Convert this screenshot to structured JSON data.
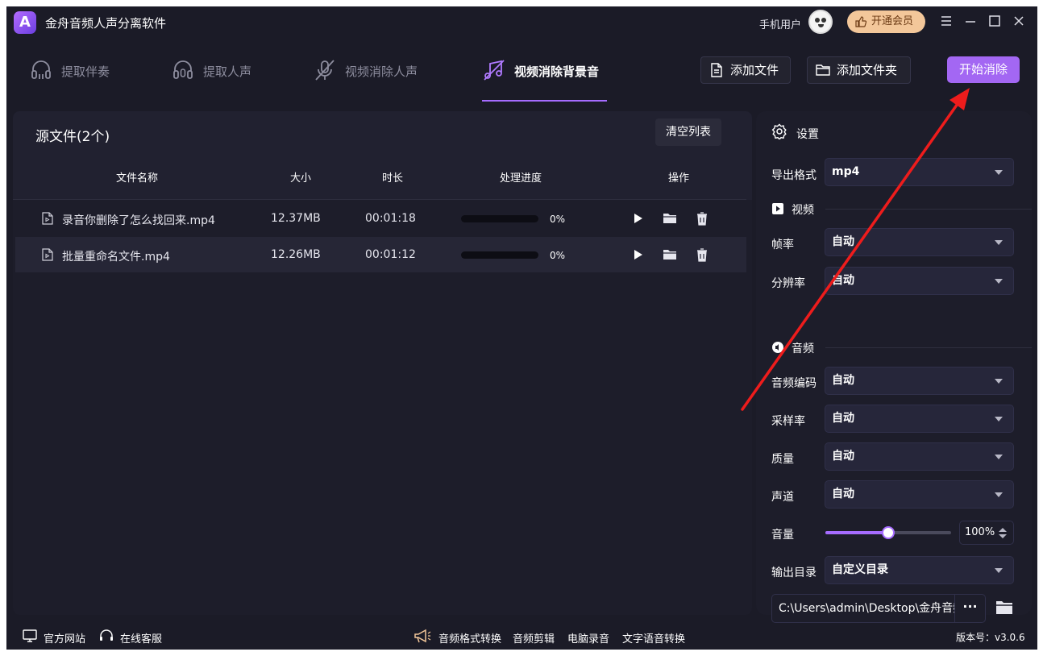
{
  "app": {
    "title": "金舟音频人声分离软件",
    "user_label": "手机用户",
    "vip_label": "开通会员"
  },
  "tabs": [
    {
      "label": "提取伴奏",
      "icon": "headphones-icon",
      "active": false
    },
    {
      "label": "提取人声",
      "icon": "headset-mic-icon",
      "active": false
    },
    {
      "label": "视频消除人声",
      "icon": "mic-off-icon",
      "active": false
    },
    {
      "label": "视频消除背景音",
      "icon": "music-off-icon",
      "active": true
    }
  ],
  "toolbar": {
    "add_file": "添加文件",
    "add_folder": "添加文件夹",
    "start": "开始消除"
  },
  "files": {
    "title": "源文件(2个)",
    "clear": "清空列表",
    "columns": [
      "文件名称",
      "大小",
      "时长",
      "处理进度",
      "操作"
    ],
    "rows": [
      {
        "name": "录音你删除了怎么找回来.mp4",
        "size": "12.37MB",
        "duration": "00:01:18",
        "progress": "0%"
      },
      {
        "name": "批量重命名文件.mp4",
        "size": "12.26MB",
        "duration": "00:01:12",
        "progress": "0%"
      }
    ]
  },
  "settings": {
    "title": "设置",
    "export_format_label": "导出格式",
    "export_format": "mp4",
    "video_section": "视频",
    "frame_rate_label": "帧率",
    "frame_rate": "自动",
    "resolution_label": "分辨率",
    "resolution": "自动",
    "audio_section": "音频",
    "audio_codec_label": "音频编码",
    "audio_codec": "自动",
    "sample_rate_label": "采样率",
    "sample_rate": "自动",
    "quality_label": "质量",
    "quality": "自动",
    "channel_label": "声道",
    "channel": "自动",
    "volume_label": "音量",
    "volume": "100%",
    "volume_fraction": 0.5,
    "output_dir_label": "输出目录",
    "output_dir": "自定义目录",
    "output_path": "C:\\Users\\admin\\Desktop\\金舟音频",
    "more": "···"
  },
  "footer": {
    "website": "官方网站",
    "support": "在线客服",
    "links": [
      "音频格式转换",
      "音频剪辑",
      "电脑录音",
      "文字语音转换"
    ],
    "version": "版本号：v3.0.6"
  },
  "colors": {
    "accent": "#a66cff",
    "background": "#1b1b27",
    "panel": "#1d1d2a",
    "vip": "#f3c79a",
    "annotation": "#ee1c1c"
  }
}
